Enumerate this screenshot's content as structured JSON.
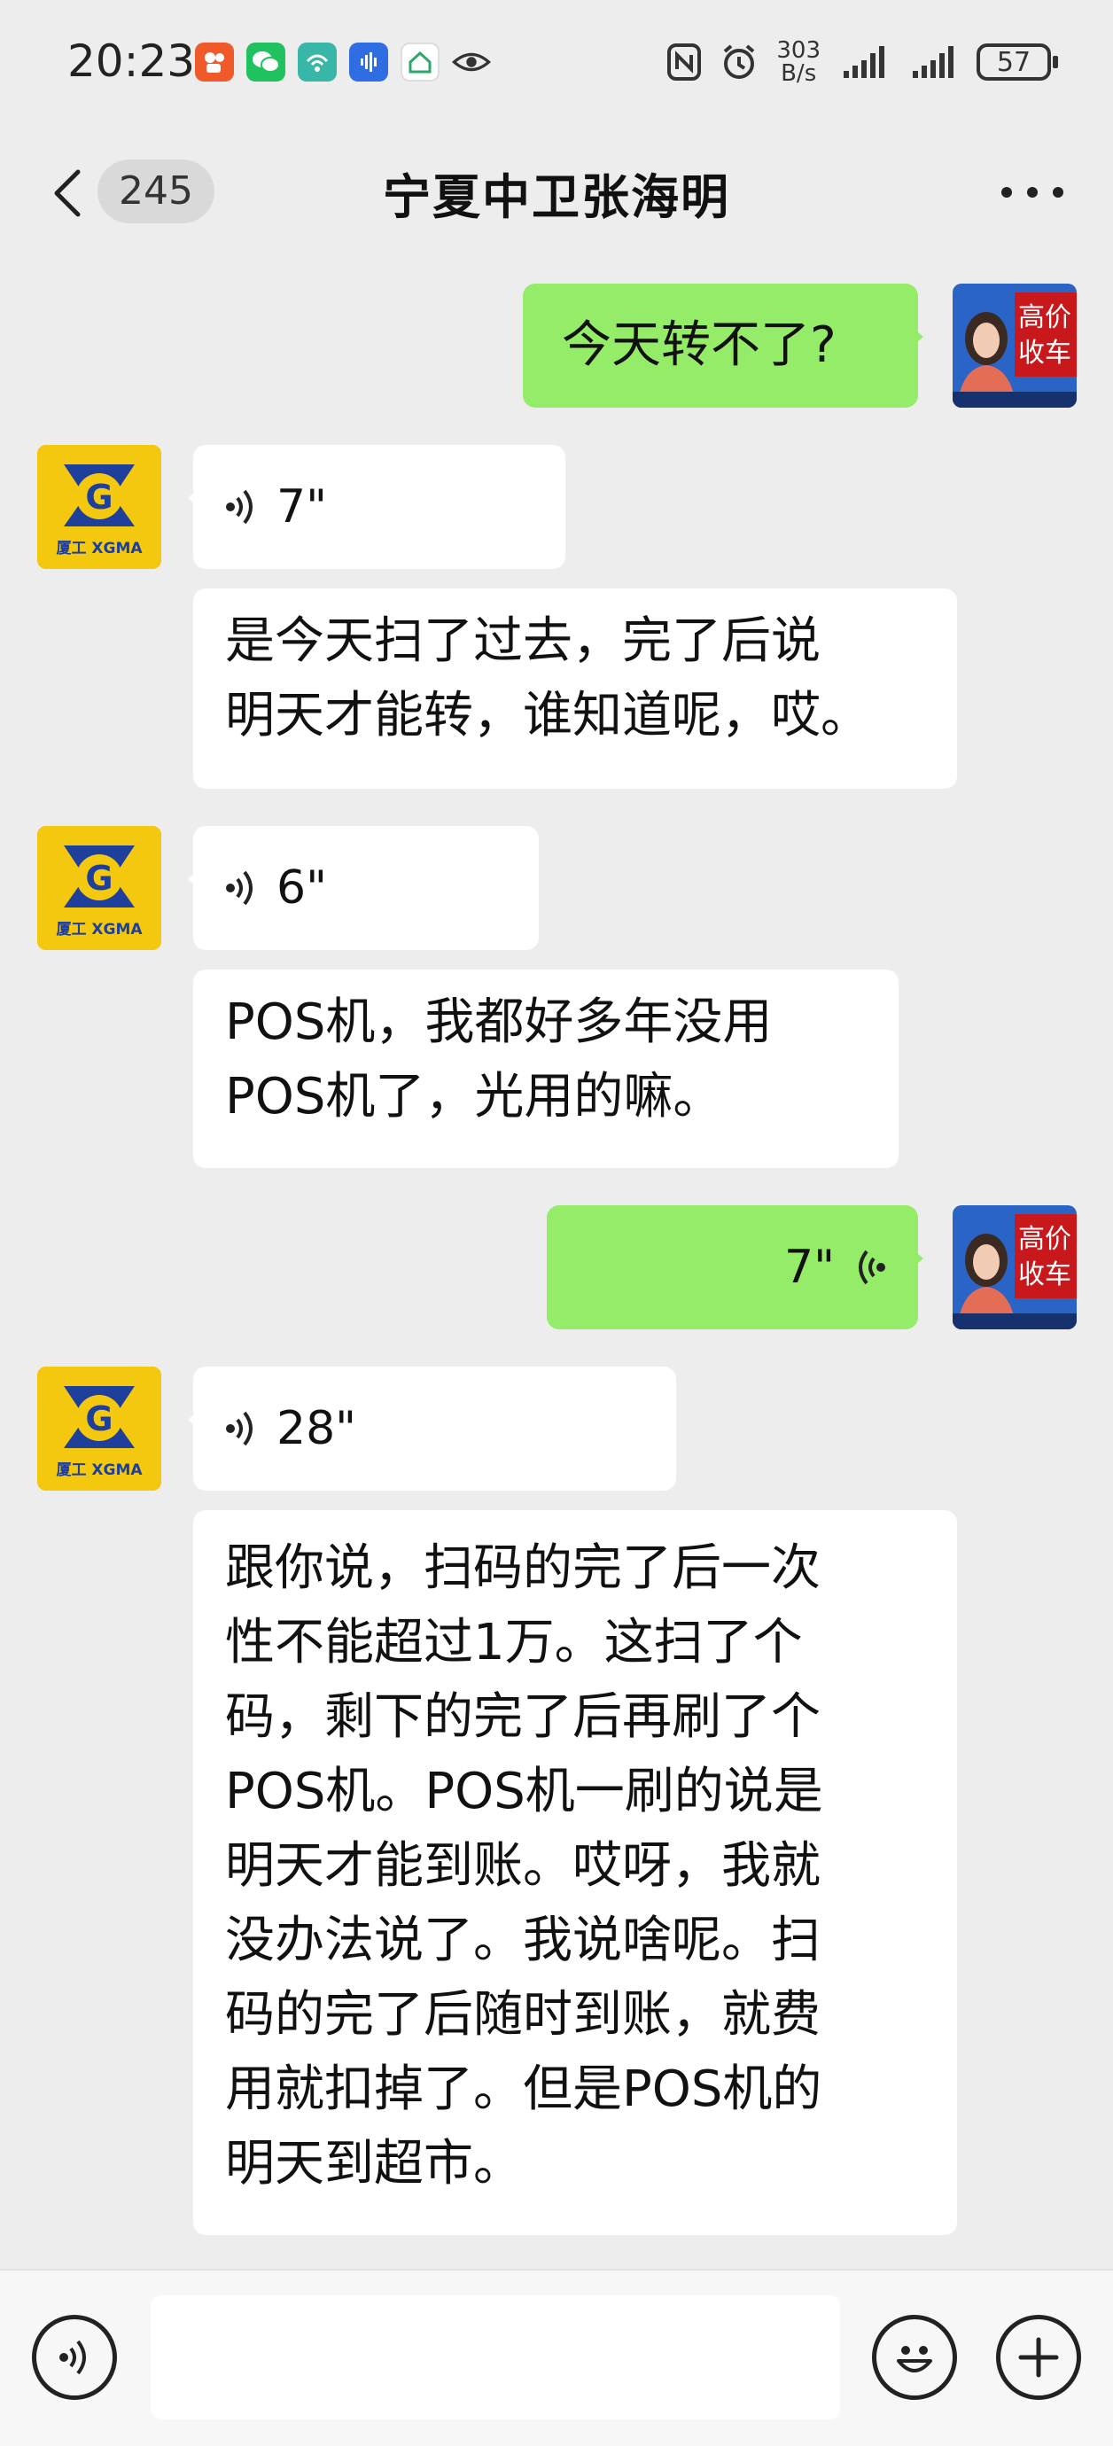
{
  "status_bar": {
    "time": "20:23",
    "speed_value": "303",
    "speed_unit": "B/s",
    "battery": "57"
  },
  "header": {
    "unread_count": "245",
    "title": "宁夏中卫张海明"
  },
  "messages": [
    {
      "side": "right",
      "type": "text",
      "text": "今天转不了?"
    },
    {
      "side": "left",
      "type": "voice",
      "duration": "7\""
    },
    {
      "side": "left",
      "type": "text",
      "lines": [
        "是今天扫了过去，完了后说",
        "明天才能转，谁知道呢，哎。"
      ]
    },
    {
      "side": "left",
      "type": "voice",
      "duration": "6\""
    },
    {
      "side": "left",
      "type": "text",
      "lines": [
        "POS机，我都好多年没用",
        "POS机了，光用的嘛。"
      ]
    },
    {
      "side": "right",
      "type": "voice",
      "duration": "7\""
    },
    {
      "side": "left",
      "type": "voice",
      "duration": "28\""
    },
    {
      "side": "left",
      "type": "text",
      "lines": [
        "跟你说，扫码的完了后一次",
        "性不能超过1万。这扫了个",
        "码，剩下的完了后再刷了个",
        "POS机。POS机一刷的说是",
        "明天才能到账。哎呀，我就",
        "没办法说了。我说啥呢。扫",
        "码的完了后随时到账，就费",
        "用就扣掉了。但是POS机的",
        "明天到超市。"
      ]
    }
  ],
  "avatars": {
    "self_banner": [
      "高价",
      "收车"
    ],
    "contact_logo": "G",
    "contact_brand": "厦工 XGMA"
  },
  "input": {
    "placeholder": ""
  },
  "colors": {
    "background": "#ededed",
    "self_bubble": "#95ec69",
    "other_bubble": "#ffffff",
    "logo_yellow": "#f3c80e",
    "logo_blue": "#1e3f9c"
  }
}
